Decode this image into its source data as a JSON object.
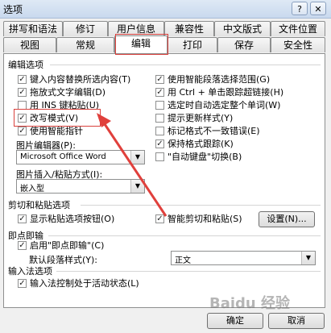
{
  "window": {
    "title": "选项",
    "help_icon": "?",
    "close_icon": "✕"
  },
  "tabs_row1": [
    "拼写和语法",
    "修订",
    "用户信息",
    "兼容性",
    "中文版式",
    "文件位置"
  ],
  "tabs_row2": [
    "视图",
    "常规",
    "编辑",
    "打印",
    "保存",
    "安全性"
  ],
  "sections": {
    "edit": "编辑选项",
    "cut_paste": "剪切和粘贴选项",
    "click_type": "即点即输",
    "ime": "输入法选项"
  },
  "edit_left": [
    {
      "label": "键入内容替换所选内容(T)",
      "checked": true
    },
    {
      "label": "拖放式文字编辑(D)",
      "checked": true
    },
    {
      "label": "用 INS 键粘贴(U)",
      "checked": false
    },
    {
      "label": "改写模式(V)",
      "checked": true
    },
    {
      "label": "使用智能指针",
      "checked": true
    }
  ],
  "edit_right": [
    {
      "label": "使用智能段落选择范围(G)",
      "checked": true
    },
    {
      "label": "用 Ctrl + 单击跟踪超链接(H)",
      "checked": true
    },
    {
      "label": "选定时自动选定整个单词(W)",
      "checked": false
    },
    {
      "label": "提示更新样式(Y)",
      "checked": false
    },
    {
      "label": "标记格式不一致错误(E)",
      "checked": false
    },
    {
      "label": "保持格式跟踪(K)",
      "checked": true
    },
    {
      "label": "\"自动键盘\"切换(B)",
      "checked": false
    }
  ],
  "picture_editor": {
    "label": "图片编辑器(P):",
    "value": "Microsoft Office Word"
  },
  "insert_paste": {
    "label": "图片插入/粘贴方式(I):",
    "value": "嵌入型"
  },
  "cut_paste": {
    "show_buttons": {
      "label": "显示粘贴选项按钮(O)",
      "checked": true
    },
    "smart_cut": {
      "label": "智能剪切和粘贴(S)",
      "checked": true
    },
    "settings_button": "设置(N)..."
  },
  "click_type": {
    "enable": {
      "label": "启用\"即点即输\"(C)",
      "checked": true
    },
    "default_style_label": "默认段落样式(Y):",
    "default_style_value": "正文"
  },
  "ime": {
    "control": {
      "label": "输入法控制处于活动状态(L)",
      "checked": true
    }
  },
  "footer": {
    "ok": "确定",
    "cancel": "取消"
  },
  "watermark": "Baidu 经验"
}
